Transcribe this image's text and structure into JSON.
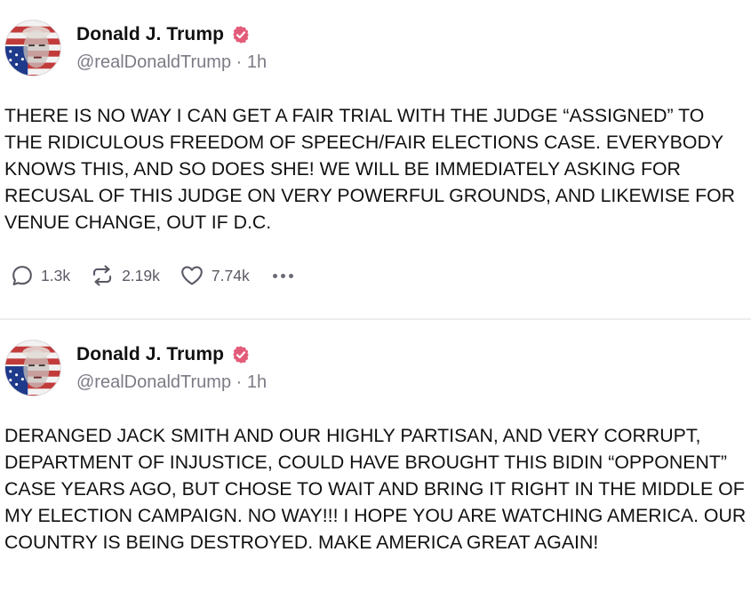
{
  "posts": [
    {
      "author": {
        "name": "Donald J. Trump",
        "handle": "@realDonaldTrump",
        "time": "1h"
      },
      "text": "THERE IS NO WAY I CAN GET A FAIR TRIAL WITH THE JUDGE “ASSIGNED” TO THE RIDICULOUS FREEDOM OF SPEECH/FAIR ELECTIONS CASE. EVERYBODY KNOWS THIS, AND SO DOES SHE! WE WILL BE IMMEDIATELY ASKING FOR RECUSAL OF THIS JUDGE ON VERY POWERFUL GROUNDS, AND LIKEWISE FOR VENUE CHANGE, OUT IF D.C.",
      "stats": {
        "replies": "1.3k",
        "retruths": "2.19k",
        "likes": "7.74k"
      }
    },
    {
      "author": {
        "name": "Donald J. Trump",
        "handle": "@realDonaldTrump",
        "time": "1h"
      },
      "text": "DERANGED JACK SMITH AND OUR HIGHLY PARTISAN, AND VERY CORRUPT, DEPARTMENT OF INJUSTICE, COULD HAVE BROUGHT THIS BIDIN “OPPONENT” CASE YEARS AGO, BUT CHOSE TO WAIT AND BRING IT RIGHT IN THE MIDDLE OF MY ELECTION CAMPAIGN. NO WAY!!! I HOPE YOU ARE WATCHING AMERICA. OUR COUNTRY IS BEING DESTROYED. MAKE AMERICA GREAT AGAIN!"
    }
  ],
  "icons": {
    "verified": "verified-badge-icon",
    "reply": "reply-bubble-icon",
    "retruth": "retruth-arrows-icon",
    "like": "heart-icon",
    "more": "more-dots-icon"
  },
  "colors": {
    "verified_badge": "#e35b7a",
    "text": "#111111",
    "muted": "#7b7b86",
    "divider": "#ececef"
  }
}
